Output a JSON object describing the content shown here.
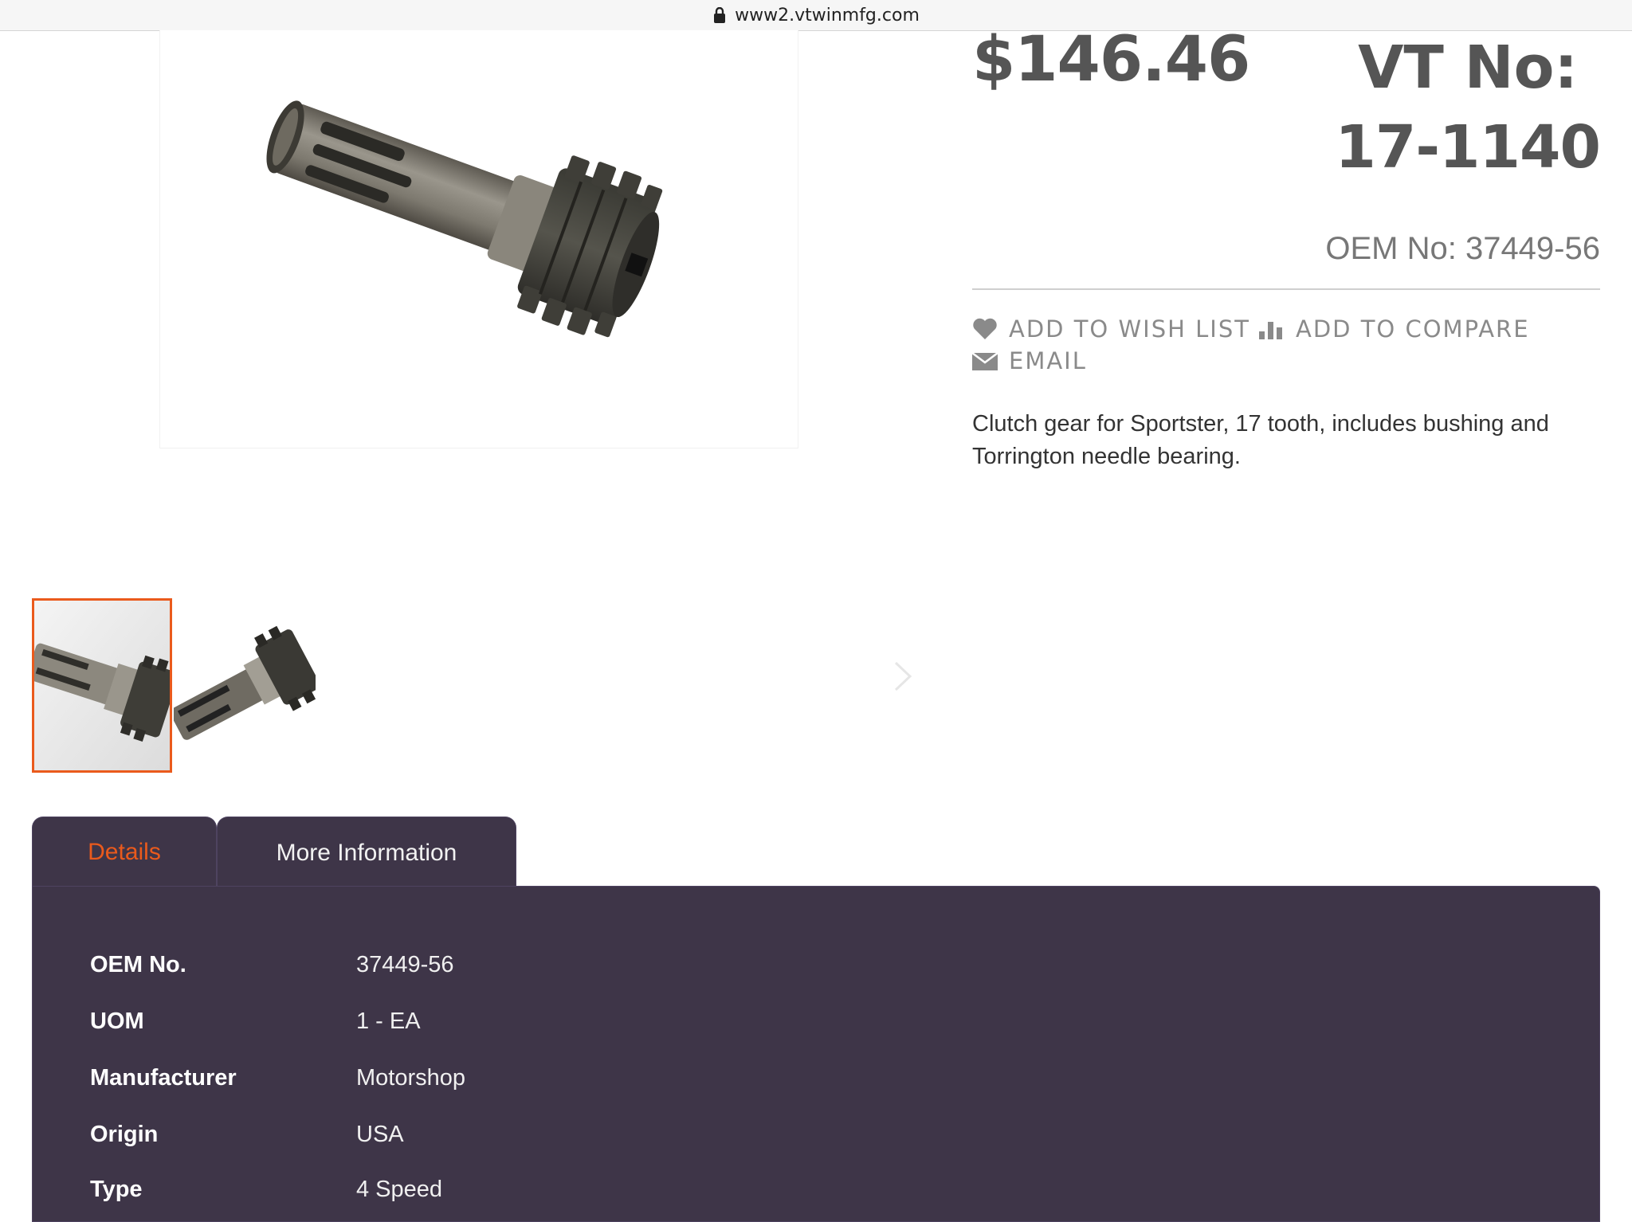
{
  "browser": {
    "url": "www2.vtwinmfg.com"
  },
  "product": {
    "price": "$146.46",
    "vt_label": "VT No:",
    "vt_number": "17-1140",
    "oem_line": "OEM No: 37449-56",
    "description": "Clutch gear for Sportster, 17 tooth, includes bushing and Torrington needle bearing."
  },
  "actions": {
    "wish_list": "ADD TO WISH LIST",
    "compare": "ADD TO COMPARE",
    "email": "EMAIL"
  },
  "tabs": [
    {
      "label": "Details",
      "color": "#ea5a1c"
    },
    {
      "label": "More Information",
      "color": "#f2f2f2"
    }
  ],
  "details": [
    {
      "label": "OEM No.",
      "value": "37449-56"
    },
    {
      "label": "UOM",
      "value": "1 - EA"
    },
    {
      "label": "Manufacturer",
      "value": "Motorshop"
    },
    {
      "label": "Origin",
      "value": "USA"
    },
    {
      "label": "Type",
      "value": "4 Speed"
    }
  ],
  "colors": {
    "accent": "#ea5a1c",
    "panel": "#3e3548",
    "text_gray": "#555555"
  }
}
